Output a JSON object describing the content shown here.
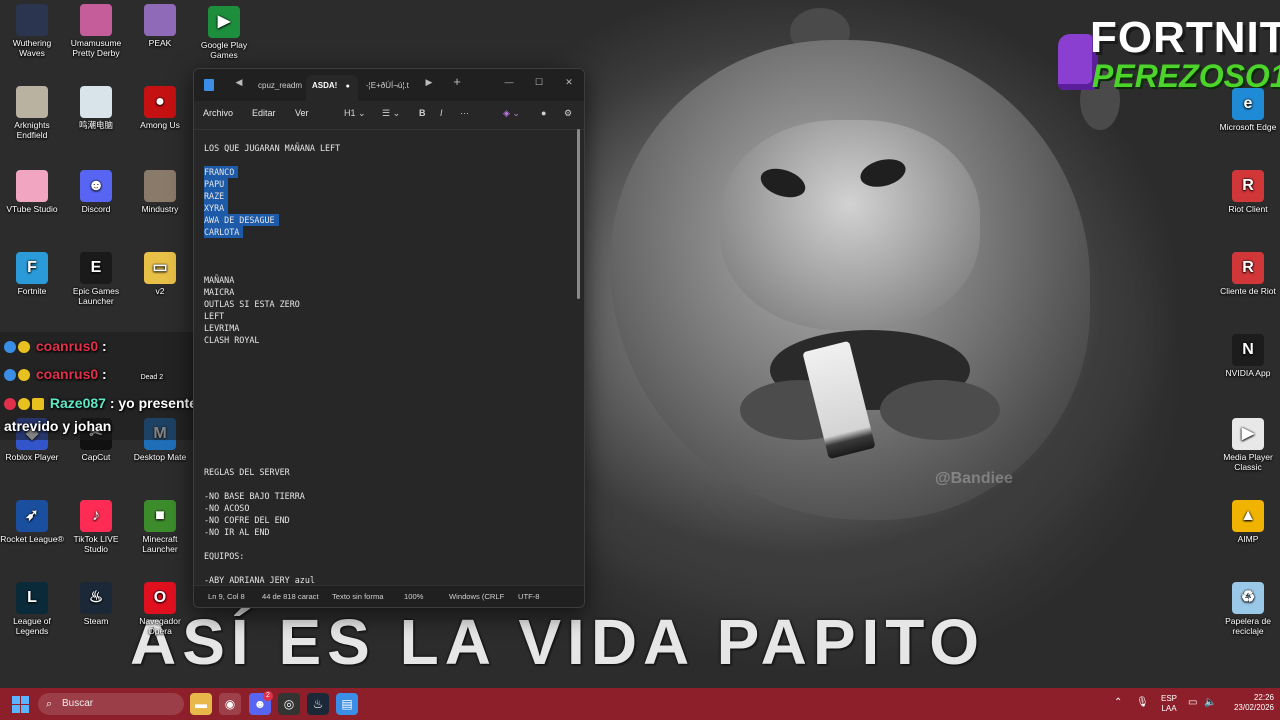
{
  "wallpaper": {
    "caption": "ASÍ ES LA VIDA PAPITO",
    "watermark": "@Bandiee"
  },
  "logo": {
    "title": "FORTNITE",
    "subtitle": "PEREZOSO1"
  },
  "desktop_icons": [
    {
      "label": "Wuthering Waves",
      "icon": "wuthering-waves-icon",
      "color": "#2b3550"
    },
    {
      "label": "Umamusume Pretty Derby",
      "icon": "umamusume-icon",
      "color": "#c55d9b"
    },
    {
      "label": "PEAK",
      "icon": "peak-icon",
      "color": "#8f6ab8"
    },
    {
      "label": "Google Play Games",
      "icon": "google-play-games-icon",
      "color": "#1c8e3c"
    },
    {
      "label": "Arknights Endfield",
      "icon": "arknights-icon",
      "color": "#b9b2a0"
    },
    {
      "label": "鸣潮电脑",
      "icon": "game-icon",
      "color": "#d9e3ea"
    },
    {
      "label": "Among Us",
      "icon": "among-us-icon",
      "color": "#c51111"
    },
    {
      "label": "VTube Studio",
      "icon": "vtube-studio-icon",
      "color": "#f2a5c0"
    },
    {
      "label": "Discord",
      "icon": "discord-icon",
      "color": "#5865f2"
    },
    {
      "label": "Mindustry",
      "icon": "mindustry-icon",
      "color": "#8a7a6a"
    },
    {
      "label": "Fortnite",
      "icon": "fortnite-icon",
      "color": "#2a9bd8"
    },
    {
      "label": "Epic Games Launcher",
      "icon": "epic-games-icon",
      "color": "#1a1a1a"
    },
    {
      "label": "v2",
      "icon": "folder-icon",
      "color": "#e8c048"
    },
    {
      "label": "Roblox Player",
      "icon": "roblox-icon",
      "color": "#3355cc"
    },
    {
      "label": "CapCut",
      "icon": "capcut-icon",
      "color": "#111111"
    },
    {
      "label": "Desktop Mate",
      "icon": "desktop-mate-icon",
      "color": "#1e6fb8"
    },
    {
      "label": "Rocket League®",
      "icon": "rocket-league-icon",
      "color": "#1a4fa0"
    },
    {
      "label": "TikTok LIVE Studio",
      "icon": "tiktok-live-icon",
      "color": "#fe2c55"
    },
    {
      "label": "Minecraft Launcher",
      "icon": "minecraft-icon",
      "color": "#3c8c2c"
    },
    {
      "label": "League of Legends",
      "icon": "league-of-legends-icon",
      "color": "#0a2a3a"
    },
    {
      "label": "Steam",
      "icon": "steam-icon",
      "color": "#1b2838"
    },
    {
      "label": "Navegador Opera",
      "icon": "opera-icon",
      "color": "#e0101f"
    },
    {
      "label": "Microsoft Edge",
      "icon": "edge-icon",
      "color": "#1f8ad6"
    },
    {
      "label": "Riot Client",
      "icon": "riot-client-icon",
      "color": "#d13639"
    },
    {
      "label": "Cliente de Riot",
      "icon": "riot-client-icon",
      "color": "#d13639"
    },
    {
      "label": "NVIDIA App",
      "icon": "nvidia-icon",
      "color": "#1c1c1c"
    },
    {
      "label": "Media Player Classic",
      "icon": "media-player-icon",
      "color": "#e8e8e8"
    },
    {
      "label": "AIMP",
      "icon": "aimp-icon",
      "color": "#f0b400"
    },
    {
      "label": "Papelera de reciclaje",
      "icon": "recycle-bin-icon",
      "color": "#9ac8e8"
    }
  ],
  "notepad": {
    "tabs": [
      "cpuz_readm",
      "ASDA!",
      "-¦E+ðÚÍ¬ú¦.t"
    ],
    "menu": [
      "Archivo",
      "Editar",
      "Ver"
    ],
    "toolbar": {
      "heading": "H1",
      "bold": "B",
      "italic": "I",
      "more": "···"
    },
    "lines": [
      {
        "text": "LOS QUE JUGARAN MAÑANA LEFT",
        "selected": false
      },
      {
        "text": "",
        "selected": false
      },
      {
        "text": "FRANCO",
        "selected": true
      },
      {
        "text": "PAPU",
        "selected": true
      },
      {
        "text": "RAZE",
        "selected": true
      },
      {
        "text": "XYRA",
        "selected": true
      },
      {
        "text": "AWA DE DESAGUE",
        "selected": true
      },
      {
        "text": "CARLOTA",
        "selected": true
      },
      {
        "text": "",
        "selected": false
      },
      {
        "text": "",
        "selected": false
      },
      {
        "text": "",
        "selected": false
      },
      {
        "text": "MAÑANA",
        "selected": false
      },
      {
        "text": "MAICRA",
        "selected": false
      },
      {
        "text": "OUTLAS SI ESTA ZERO",
        "selected": false
      },
      {
        "text": "LEFT",
        "selected": false
      },
      {
        "text": "LEVRIMA",
        "selected": false
      },
      {
        "text": "CLASH ROYAL",
        "selected": false
      },
      {
        "text": "",
        "selected": false
      },
      {
        "text": "",
        "selected": false
      },
      {
        "text": "",
        "selected": false
      },
      {
        "text": "",
        "selected": false
      },
      {
        "text": "",
        "selected": false
      },
      {
        "text": "",
        "selected": false
      },
      {
        "text": "",
        "selected": false
      },
      {
        "text": "",
        "selected": false
      },
      {
        "text": "",
        "selected": false
      },
      {
        "text": "",
        "selected": false
      },
      {
        "text": "REGLAS DEL SERVER",
        "selected": false
      },
      {
        "text": "",
        "selected": false
      },
      {
        "text": "-NO BASE BAJO TIERRA",
        "selected": false
      },
      {
        "text": "-NO ACOSO",
        "selected": false
      },
      {
        "text": "-NO COFRE DEL END",
        "selected": false
      },
      {
        "text": "-NO IR AL END",
        "selected": false
      },
      {
        "text": "",
        "selected": false
      },
      {
        "text": "EQUIPOS:",
        "selected": false
      },
      {
        "text": "",
        "selected": false
      },
      {
        "text": "-ABY ADRIANA JERY azul",
        "selected": false
      }
    ],
    "status": {
      "position": "Ln 9, Col 8",
      "chars": "44 de 818 caract",
      "format": "Texto sin forma",
      "zoom": "100%",
      "line_ending": "Windows (CRLF",
      "encoding": "UTF-8"
    }
  },
  "chat": [
    {
      "user": "coanrus0",
      "message": ":"
    },
    {
      "user": "coanrus0",
      "message": ":"
    },
    {
      "user": "Raze087",
      "message": ": yo presente para slot a"
    },
    {
      "user": "",
      "message": "atrevido y johan"
    }
  ],
  "chat_sub": {
    "dead": "Dead 2"
  },
  "taskbar": {
    "search_placeholder": "Buscar",
    "lang_top": "ESP",
    "lang_bottom": "LAA",
    "time": "22:26",
    "date": "23/02/2026",
    "discord_badge": "2"
  }
}
